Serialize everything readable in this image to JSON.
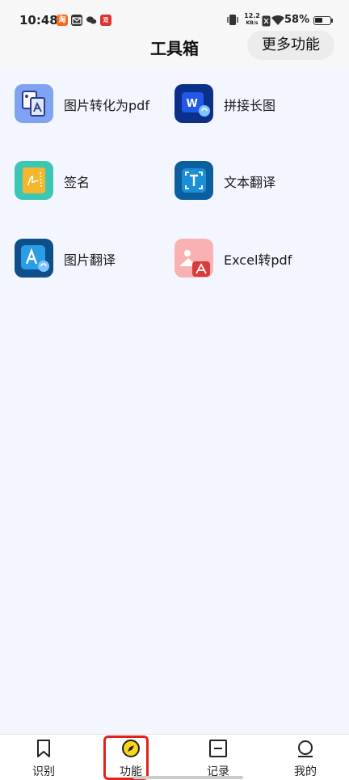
{
  "status_bar": {
    "time": "10:48",
    "net_speed_value": "12.2",
    "net_speed_unit": "KB/s",
    "battery_percent": "58%",
    "battery_level": 0.58,
    "notifications": [
      "app-notification-icon",
      "mail-icon",
      "wechat-icon",
      "shopping-app-icon"
    ],
    "notification_badges": {
      "app": "淘",
      "shop": "双11"
    }
  },
  "header": {
    "title": "工具箱",
    "more_label": "更多功能"
  },
  "tools": [
    {
      "label": "图片转化为pdf",
      "icon": "image-to-pdf-icon",
      "color": "#7fa3f0"
    },
    {
      "label": "拼接长图",
      "icon": "word-merge-icon",
      "color": "#1d4ed8"
    },
    {
      "label": "签名",
      "icon": "signature-icon",
      "color": "#3cc7b5"
    },
    {
      "label": "文本翻译",
      "icon": "text-translate-icon",
      "color": "#0b72b7"
    },
    {
      "label": "图片翻译",
      "icon": "image-translate-icon",
      "color": "#1e88d6"
    },
    {
      "label": "Excel转pdf",
      "icon": "excel-to-pdf-icon",
      "color": "#f7a6a6"
    }
  ],
  "bottom_nav": [
    {
      "label": "识别",
      "icon": "bookmark-icon"
    },
    {
      "label": "功能",
      "icon": "compass-icon",
      "active": true
    },
    {
      "label": "记录",
      "icon": "record-icon"
    },
    {
      "label": "我的",
      "icon": "profile-icon"
    }
  ]
}
